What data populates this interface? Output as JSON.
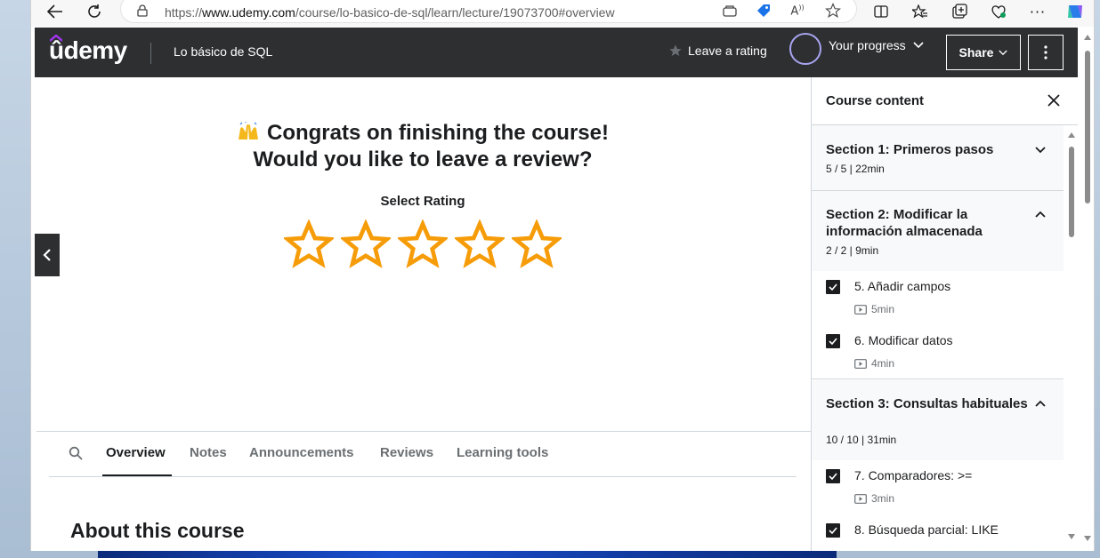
{
  "browser": {
    "url_prefix": "https://",
    "url_domain": "www.udemy.com",
    "url_path": "/course/lo-basico-de-sql/learn/lecture/19073700#overview"
  },
  "header": {
    "logo": "ûdemy",
    "course_title": "Lo básico de SQL",
    "leave_rating": "Leave a rating",
    "progress": "Your progress",
    "share": "Share"
  },
  "review": {
    "line1": "Congrats on finishing the course!",
    "line2": "Would you like to leave a review?",
    "select_rating": "Select Rating",
    "stars": 5
  },
  "tabs": [
    {
      "label": "Overview",
      "active": true
    },
    {
      "label": "Notes",
      "active": false
    },
    {
      "label": "Announcements",
      "active": false
    },
    {
      "label": "Reviews",
      "active": false
    },
    {
      "label": "Learning tools",
      "active": false
    }
  ],
  "about": "About this course",
  "sidebar": {
    "title": "Course content",
    "sections": [
      {
        "title": "Section 1: Primeros pasos",
        "meta": "5 / 5 | 22min",
        "expanded": false
      },
      {
        "title": "Section 2: Modificar la información almacenada",
        "meta": "2 / 2 | 9min",
        "expanded": true
      },
      {
        "title": "Section 3: Consultas habituales",
        "meta": "10 / 10 | 31min",
        "expanded": true
      }
    ],
    "lectures": [
      {
        "title": "5. Añadir campos",
        "duration": "5min"
      },
      {
        "title": "6. Modificar datos",
        "duration": "4min"
      },
      {
        "title": "7. Comparadores: >=",
        "duration": "3min"
      },
      {
        "title": "8. Búsqueda parcial: LIKE",
        "duration": ""
      }
    ]
  },
  "colors": {
    "header_bg": "#2d2f31",
    "star": "#f69c08",
    "progress_ring": "#a8a4ef"
  }
}
